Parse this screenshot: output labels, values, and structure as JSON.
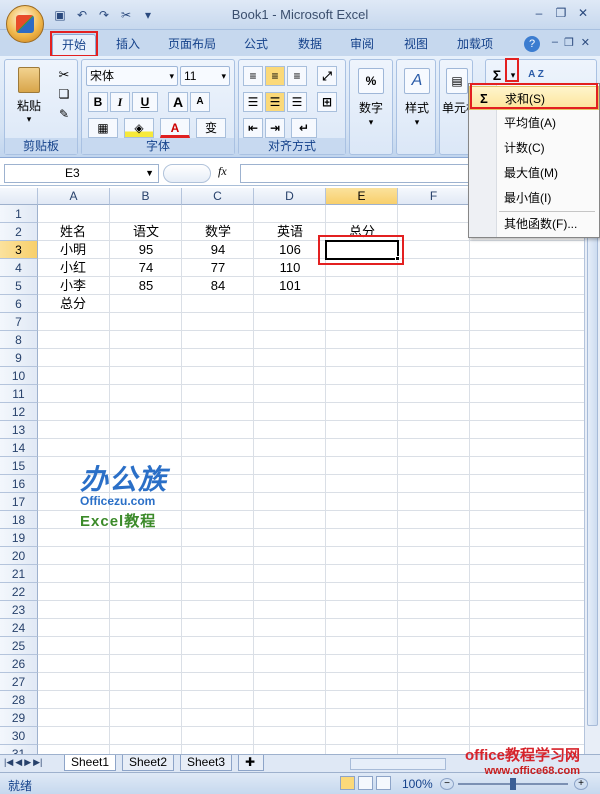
{
  "window": {
    "title": "Book1 - Microsoft Excel"
  },
  "tabs": [
    "开始",
    "插入",
    "页面布局",
    "公式",
    "数据",
    "审阅",
    "视图",
    "加载项"
  ],
  "ribbon": {
    "clipboard": {
      "label": "剪贴板",
      "paste": "粘贴"
    },
    "font": {
      "label": "字体",
      "name": "宋体",
      "size": "11",
      "bold": "B",
      "italic": "I",
      "underline": "U",
      "grow": "A",
      "shrink": "A",
      "font_color_glyph": "A",
      "phonetic": "变"
    },
    "align": {
      "label": "对齐方式"
    },
    "number": {
      "label": "数字",
      "percent": "%"
    },
    "styles": {
      "label": "样式",
      "glyph": "A"
    },
    "cells": {
      "label": "单元格"
    },
    "editing": {
      "sum_glyph": "Σ",
      "sort_glyph": "A Z"
    }
  },
  "formula_bar": {
    "name_box": "E3",
    "fx": "fx",
    "content": ""
  },
  "sheet": {
    "columns": [
      "A",
      "B",
      "C",
      "D",
      "E",
      "F"
    ],
    "rows": [
      "1",
      "2",
      "3",
      "4",
      "5",
      "6",
      "7",
      "8",
      "9",
      "10",
      "11",
      "12",
      "13",
      "14",
      "15",
      "16",
      "17",
      "18",
      "19",
      "20",
      "21",
      "22",
      "23",
      "24",
      "25",
      "26",
      "27",
      "28",
      "29",
      "30",
      "31"
    ],
    "cells": {
      "A2": "姓名",
      "B2": "语文",
      "C2": "数学",
      "D2": "英语",
      "E2": "总分",
      "A3": "小明",
      "B3": "95",
      "C3": "94",
      "D3": "106",
      "A4": "小红",
      "B4": "74",
      "C4": "77",
      "D4": "110",
      "A5": "小李",
      "B5": "85",
      "C5": "84",
      "D5": "101",
      "A6": "总分"
    },
    "active_cell": "E3"
  },
  "sheet_tabs": [
    "Sheet1",
    "Sheet2",
    "Sheet3"
  ],
  "status": {
    "ready": "就绪",
    "zoom": "100%"
  },
  "autosum_menu": {
    "items": [
      {
        "label": "求和(S)",
        "icon": "Σ"
      },
      {
        "label": "平均值(A)"
      },
      {
        "label": "计数(C)"
      },
      {
        "label": "最大值(M)"
      },
      {
        "label": "最小值(I)"
      },
      {
        "label": "其他函数(F)..."
      }
    ]
  },
  "watermark": {
    "brand_cn": "办公族",
    "brand_url": "Officezu.com",
    "tutorial": "Excel教程"
  },
  "footer_watermark": {
    "line1": "office教程学习网",
    "line2": "www.office68.com"
  },
  "colors": {
    "accent_red": "#e32020",
    "ribbon_text": "#15428b",
    "selected_header": "#f8cf6b"
  }
}
